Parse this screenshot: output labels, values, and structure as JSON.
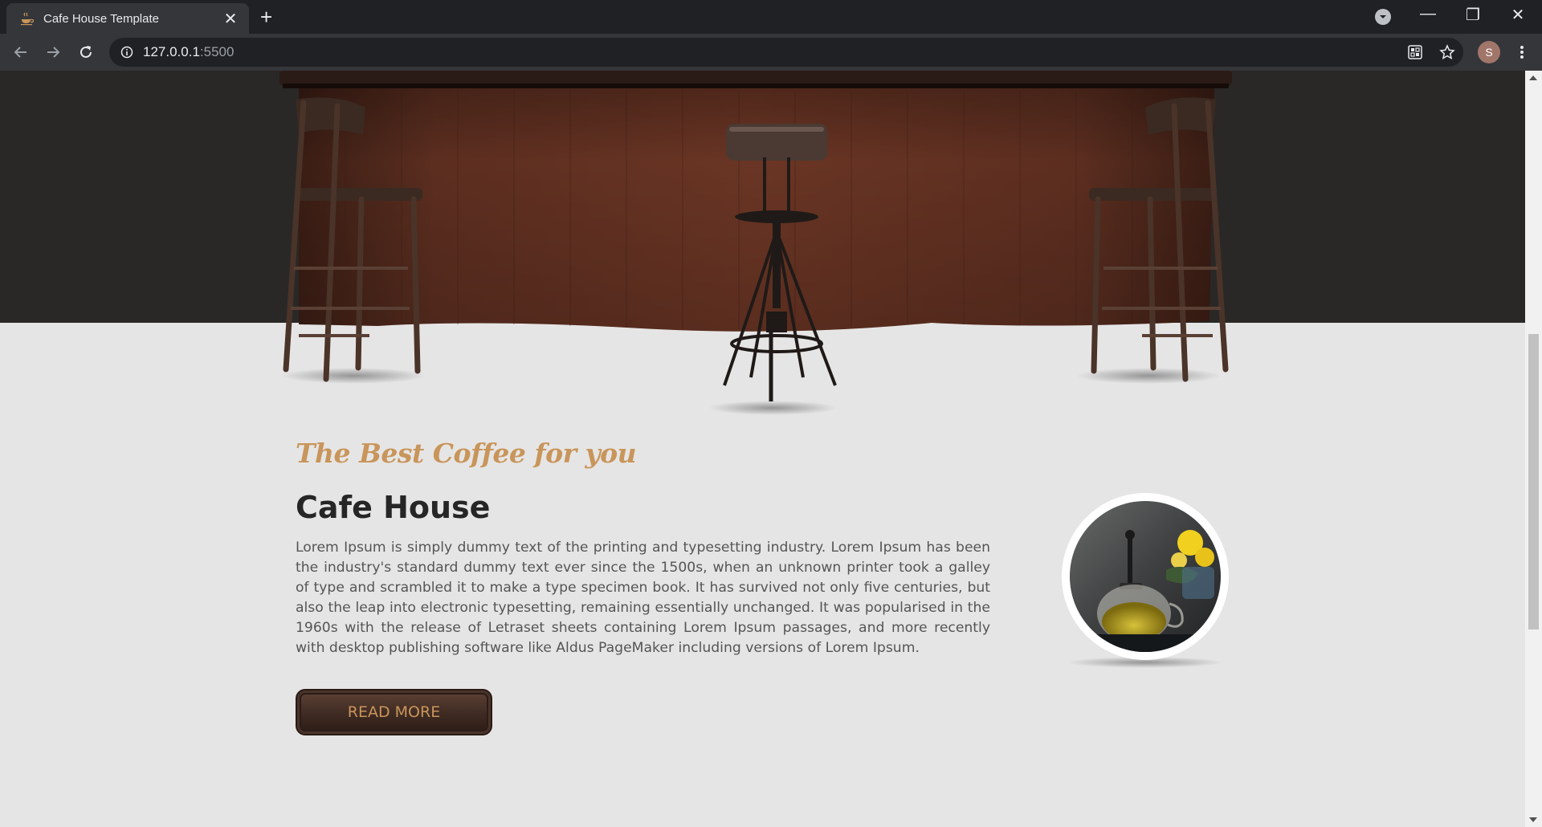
{
  "browser": {
    "tab": {
      "title": "Cafe House Template",
      "close_glyph": "✕"
    },
    "new_tab_glyph": "+",
    "window": {
      "minimize": "—",
      "restore": "❐",
      "close": "✕"
    },
    "address": {
      "host": "127.0.0.1",
      "port": ":5500"
    },
    "profile_initial": "S"
  },
  "hero": {
    "tagline": "The Best Coffee for you",
    "title": "Cafe House",
    "body": "Lorem Ipsum is simply dummy text of the printing and typesetting industry. Lorem Ipsum has been the industry's standard dummy text ever since the 1500s, when an unknown printer took a galley of type and scrambled it to make a type specimen book. It has survived not only five centuries, but also the leap into electronic typesetting, remaining essentially unchanged. It was popularised in the 1960s with the release of Letraset sheets containing Lorem Ipsum passages, and more recently with desktop publishing software like Aldus PageMaker including versions of Lorem Ipsum.",
    "button": "READ MORE"
  },
  "colors": {
    "accent": "#c8955a",
    "dark_band": "#292827",
    "page_bg": "#e6e5e5",
    "heading": "#262626",
    "body_text": "#555555"
  },
  "icons": [
    "coffee-cup-favicon-icon",
    "close-icon",
    "plus-icon",
    "tab-search-icon",
    "minimize-icon",
    "restore-icon",
    "window-close-icon",
    "back-arrow-icon",
    "forward-arrow-icon",
    "reload-icon",
    "info-icon",
    "translate-icon",
    "star-icon",
    "menu-dots-icon"
  ]
}
